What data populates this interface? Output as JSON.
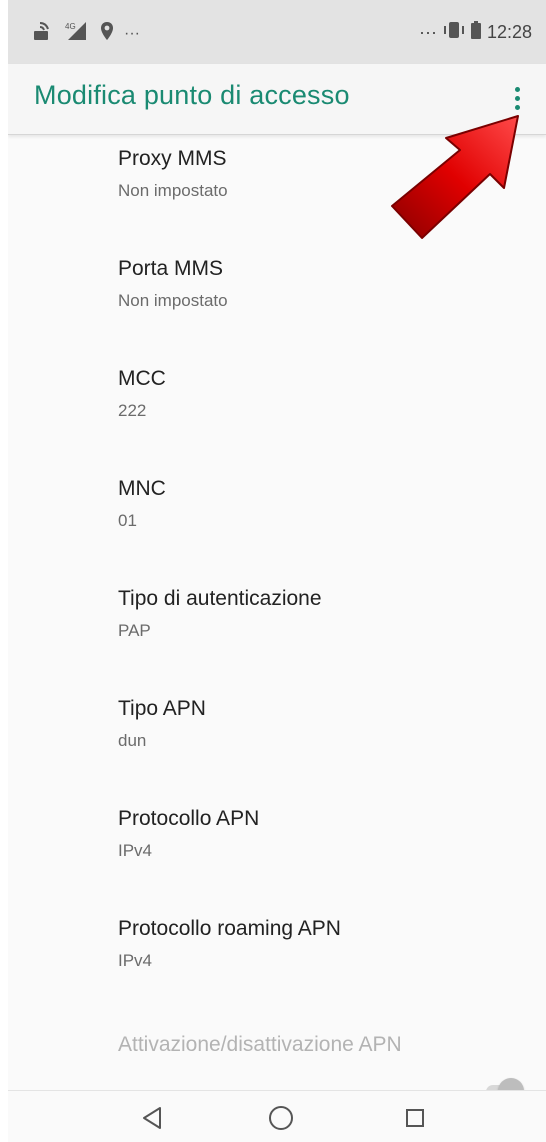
{
  "status_bar": {
    "left_icons": [
      "volte-icon",
      "4g-signal-icon",
      "location-icon"
    ],
    "left_overflow": "···",
    "right_overflow": "···",
    "time": "12:28"
  },
  "app_bar": {
    "title": "Modifica punto di accesso",
    "accent_color": "#1a8a72"
  },
  "settings": [
    {
      "title": "Proxy MMS",
      "value": "Non impostato"
    },
    {
      "title": "Porta MMS",
      "value": "Non impostato"
    },
    {
      "title": "MCC",
      "value": "222"
    },
    {
      "title": "MNC",
      "value": "01"
    },
    {
      "title": "Tipo di autenticazione",
      "value": "PAP"
    },
    {
      "title": "Tipo APN",
      "value": "dun"
    },
    {
      "title": "Protocollo APN",
      "value": "IPv4"
    },
    {
      "title": "Protocollo roaming APN",
      "value": "IPv4"
    }
  ],
  "apn_toggle": {
    "title": "Attivazione/disattivazione APN",
    "enabled": false,
    "checked": true
  },
  "nav_bar": {
    "buttons": [
      "back-icon",
      "home-icon",
      "recents-icon"
    ]
  },
  "annotation": {
    "icon": "red-arrow-icon",
    "color": "#d40000"
  }
}
